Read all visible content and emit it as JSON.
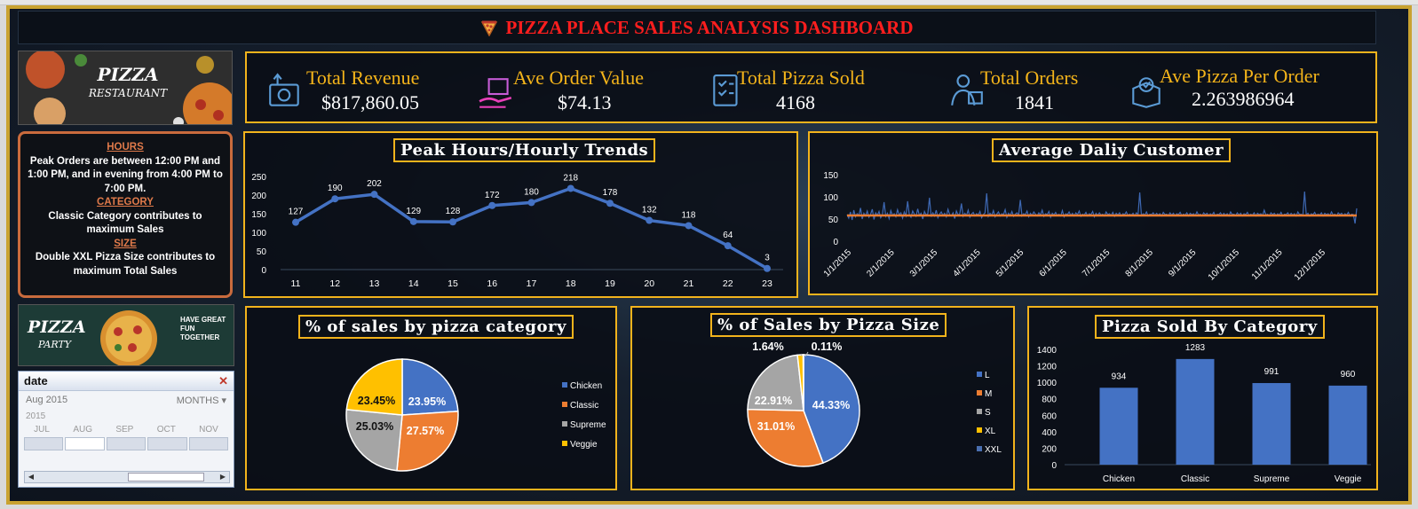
{
  "title": "PIZZA PLACE SALES ANALYSIS DASHBOARD",
  "kpis": [
    {
      "label": "Total Revenue",
      "value": "$817,860.05",
      "icon": "revenue-icon"
    },
    {
      "label": "Ave Order Value",
      "value": "$74.13",
      "icon": "order-value-icon"
    },
    {
      "label": "Total Pizza Sold",
      "value": "4168",
      "icon": "checklist-icon"
    },
    {
      "label": "Total  Orders",
      "value": "1841",
      "icon": "delivery-person-icon"
    },
    {
      "label": "Ave Pizza Per Order",
      "value": "2.263986964",
      "icon": "box-icon"
    }
  ],
  "images": {
    "restaurant_title": "PIZZA",
    "restaurant_subtitle": "RESTAURANT",
    "party_title": "PIZZA",
    "party_subtitle": "PARTY",
    "party_tagline": "HAVE GREAT FUN TOGETHER"
  },
  "notes": {
    "hours_heading": "HOURS",
    "hours_text": "Peak Orders are between 12:00 PM and 1:00 PM, and in evening from 4:00 PM to 7:00 PM.",
    "category_heading": "CATEGORY",
    "category_text": "Classic Category contributes to maximum Sales",
    "size_heading": "SIZE",
    "size_text": "Double XXL Pizza Size contributes to maximum Total Sales"
  },
  "slicer": {
    "header": "date",
    "selection": "Aug 2015",
    "level": "MONTHS",
    "year": "2015",
    "months": [
      "JUL",
      "AUG",
      "SEP",
      "OCT",
      "NOV"
    ],
    "selected_month": "AUG"
  },
  "colors": {
    "accent_gold": "#f2b31c",
    "title_red": "#ff1e1e",
    "blue": "#4472c4",
    "orange": "#ed7d31",
    "gray": "#a5a5a5",
    "yellow": "#ffc000"
  },
  "chart_data": [
    {
      "id": "hourly",
      "type": "line",
      "title": "Peak Hours/Hourly Trends",
      "x": [
        "11",
        "12",
        "13",
        "14",
        "15",
        "16",
        "17",
        "18",
        "19",
        "20",
        "21",
        "22",
        "23"
      ],
      "values": [
        127,
        190,
        202,
        129,
        128,
        172,
        180,
        218,
        178,
        132,
        118,
        64,
        3
      ],
      "yticks": [
        0,
        50,
        100,
        150,
        200,
        250
      ],
      "ylim": [
        0,
        250
      ]
    },
    {
      "id": "daily",
      "type": "line",
      "title": "Average Daliy Customer",
      "x_labels": [
        "1/1/2015",
        "2/1/2015",
        "3/1/2015",
        "4/1/2015",
        "5/1/2015",
        "6/1/2015",
        "7/1/2015",
        "8/1/2015",
        "9/1/2015",
        "10/1/2015",
        "11/1/2015",
        "12/1/2015"
      ],
      "yticks": [
        0,
        50,
        100,
        150
      ],
      "ylim": [
        0,
        150
      ],
      "series": [
        {
          "values": [
            60,
            52,
            66,
            48,
            70,
            55,
            62,
            58,
            75,
            50,
            63,
            57,
            68,
            54,
            61,
            72,
            49,
            64,
            58,
            67,
            53,
            60,
            88,
            56,
            63,
            51,
            69,
            58,
            62,
            55,
            71,
            59,
            64,
            52,
            66,
            57,
            90,
            60,
            54,
            68,
            61,
            56,
            73,
            58,
            63,
            50,
            67,
            59,
            62,
            98,
            55,
            64,
            57,
            70,
            53,
            61,
            66,
            58,
            63,
            55,
            72,
            60,
            57,
            64,
            51,
            68,
            59,
            62,
            85,
            56,
            63,
            58,
            70,
            54,
            61,
            65,
            57,
            62,
            59,
            67,
            53,
            60,
            64,
            108,
            56,
            63,
            58,
            69,
            55,
            61,
            66,
            57,
            62,
            60,
            71,
            54,
            63,
            58,
            67,
            56,
            61,
            64,
            59,
            93,
            57,
            62,
            60,
            68,
            55,
            63,
            58,
            66,
            61,
            57,
            64,
            59,
            70,
            56,
            62,
            60,
            67,
            54,
            63,
            59,
            65,
            58,
            61,
            57,
            69,
            55,
            62,
            60,
            66,
            58,
            63,
            57,
            64,
            60,
            68,
            56,
            61,
            59,
            65,
            57,
            62,
            60,
            67,
            55,
            63,
            58,
            64,
            59,
            61,
            57,
            66,
            60,
            62,
            58,
            65,
            56,
            63,
            59,
            64,
            57,
            62,
            60,
            66,
            58,
            61,
            59,
            63,
            57,
            64,
            60,
            110,
            58,
            62,
            59,
            66,
            57,
            61,
            60,
            64,
            58,
            63,
            59,
            62,
            57,
            65,
            60,
            61,
            58,
            64,
            59,
            63,
            57,
            62,
            60,
            65,
            58,
            61,
            59,
            64,
            57,
            63,
            60,
            62,
            58,
            66,
            59,
            61,
            57,
            64,
            60,
            63,
            58,
            62,
            59,
            65,
            57,
            61,
            60,
            64,
            58,
            63,
            59,
            62,
            57,
            66,
            60,
            61,
            58,
            64,
            59,
            63,
            57,
            62,
            60,
            65,
            58,
            61,
            59,
            64,
            57,
            63,
            60,
            62,
            58,
            70,
            59,
            61,
            57,
            64,
            60,
            63,
            58,
            62,
            59,
            65,
            57,
            61,
            60,
            64,
            58,
            63,
            59,
            62,
            57,
            66,
            60,
            61,
            58,
            112,
            59,
            63,
            57,
            62,
            60,
            65,
            58,
            61,
            59,
            64,
            57,
            63,
            60,
            62,
            58,
            66,
            59,
            61,
            57,
            64,
            60,
            63,
            58,
            62,
            59,
            65,
            57,
            61,
            60,
            40,
            74
          ]
        },
        {
          "values": [
            58,
            58,
            58,
            58,
            58,
            58,
            58,
            58,
            58,
            58,
            58,
            58
          ]
        }
      ]
    },
    {
      "id": "category_pie",
      "type": "pie",
      "title": "% of sales by pizza category",
      "labels": [
        "Chicken",
        "Classic",
        "Supreme",
        "Veggie"
      ],
      "values": [
        23.95,
        27.57,
        25.03,
        23.45
      ],
      "value_labels": [
        "23.95%",
        "27.57%",
        "25.03%",
        "23.45%"
      ]
    },
    {
      "id": "size_pie",
      "type": "pie",
      "title": "% of Sales by Pizza Size",
      "labels": [
        "L",
        "M",
        "S",
        "XL",
        "XXL"
      ],
      "values": [
        44.33,
        31.01,
        22.91,
        1.64,
        0.11
      ],
      "value_labels": [
        "44.33%",
        "31.01%",
        "22.91%",
        "1.64%",
        "0.11%"
      ]
    },
    {
      "id": "category_bar",
      "type": "bar",
      "title": "Pizza Sold By Category",
      "categories": [
        "Chicken",
        "Classic",
        "Supreme",
        "Veggie"
      ],
      "values": [
        934,
        1283,
        991,
        960
      ],
      "yticks": [
        0,
        200,
        400,
        600,
        800,
        1000,
        1200,
        1400
      ],
      "ylim": [
        0,
        1400
      ]
    }
  ]
}
